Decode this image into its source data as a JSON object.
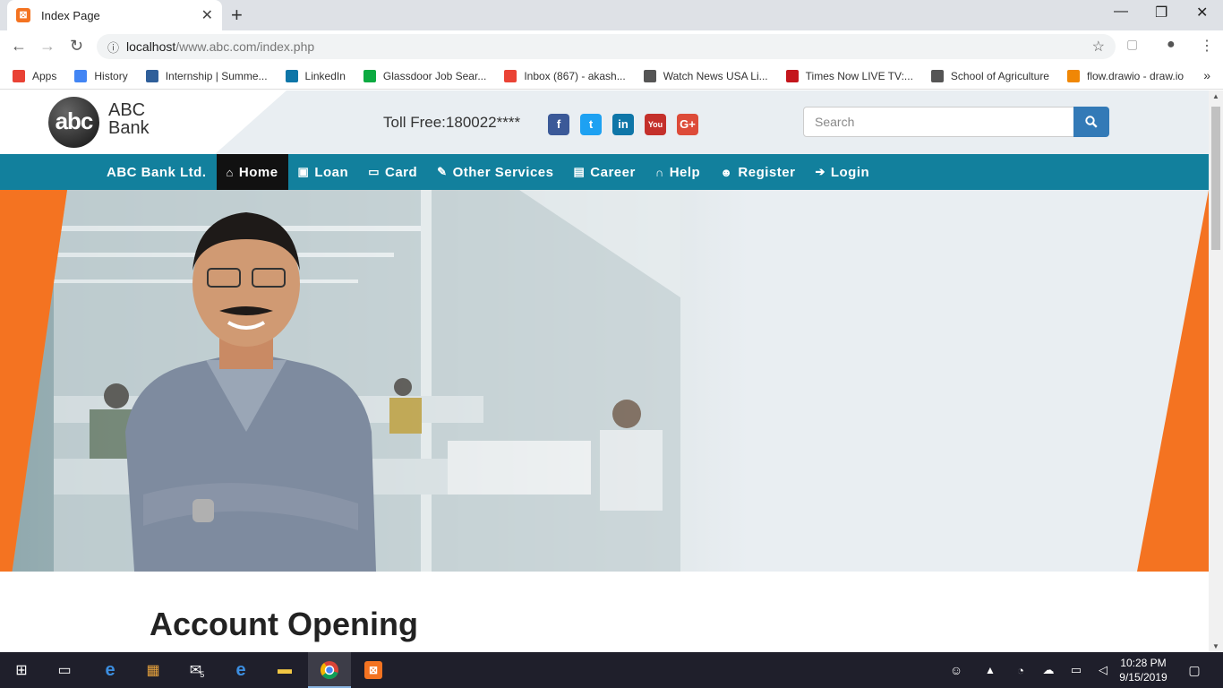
{
  "browser": {
    "tab_title": "Index Page",
    "url_host": "localhost",
    "url_path": "/www.abc.com/index.php",
    "bookmarks": [
      {
        "label": "Apps",
        "color": "#e94235"
      },
      {
        "label": "History",
        "color": "#4285f4"
      },
      {
        "label": "Internship | Summe...",
        "color": "#2f5f9a"
      },
      {
        "label": "LinkedIn",
        "color": "#0e76a8"
      },
      {
        "label": "Glassdoor Job Sear...",
        "color": "#0caa41"
      },
      {
        "label": "Inbox (867) - akash...",
        "color": "#ea4335"
      },
      {
        "label": "Watch News USA Li...",
        "color": "#555555"
      },
      {
        "label": "Times Now LIVE TV:...",
        "color": "#c4161c"
      },
      {
        "label": "School of Agriculture",
        "color": "#555555"
      },
      {
        "label": "flow.drawio - draw.io",
        "color": "#f08705"
      }
    ]
  },
  "site": {
    "logo_mark": "abc",
    "logo_line1": "ABC",
    "logo_line2": "Bank",
    "toll_free": "Toll Free:180022****",
    "social": [
      {
        "name": "facebook-icon",
        "glyph": "f",
        "color": "#3b5998"
      },
      {
        "name": "twitter-icon",
        "glyph": "t",
        "color": "#1da1f2"
      },
      {
        "name": "linkedin-icon",
        "glyph": "in",
        "color": "#0e76a8"
      },
      {
        "name": "youtube-icon",
        "glyph": "You",
        "color": "#c4302b"
      },
      {
        "name": "googleplus-icon",
        "glyph": "G+",
        "color": "#dd4b39"
      }
    ],
    "search_placeholder": "Search",
    "nav": {
      "brand": "ABC Bank Ltd.",
      "items": [
        {
          "label": "Home",
          "icon": "home-icon",
          "glyph": "⌂"
        },
        {
          "label": "Loan",
          "icon": "money-icon",
          "glyph": "▣"
        },
        {
          "label": "Card",
          "icon": "credit-card-icon",
          "glyph": "▭"
        },
        {
          "label": "Other Services",
          "icon": "wrench-icon",
          "glyph": "✎"
        },
        {
          "label": "Career",
          "icon": "briefcase-icon",
          "glyph": "▤"
        },
        {
          "label": "Help",
          "icon": "headphones-icon",
          "glyph": "∩"
        },
        {
          "label": "Register",
          "icon": "user-icon",
          "glyph": "☻"
        },
        {
          "label": "Login",
          "icon": "login-icon",
          "glyph": "➔"
        }
      ]
    },
    "section_title": "Account Opening"
  },
  "taskbar": {
    "time": "10:28 PM",
    "date": "9/15/2019",
    "mail_badge": "5"
  }
}
